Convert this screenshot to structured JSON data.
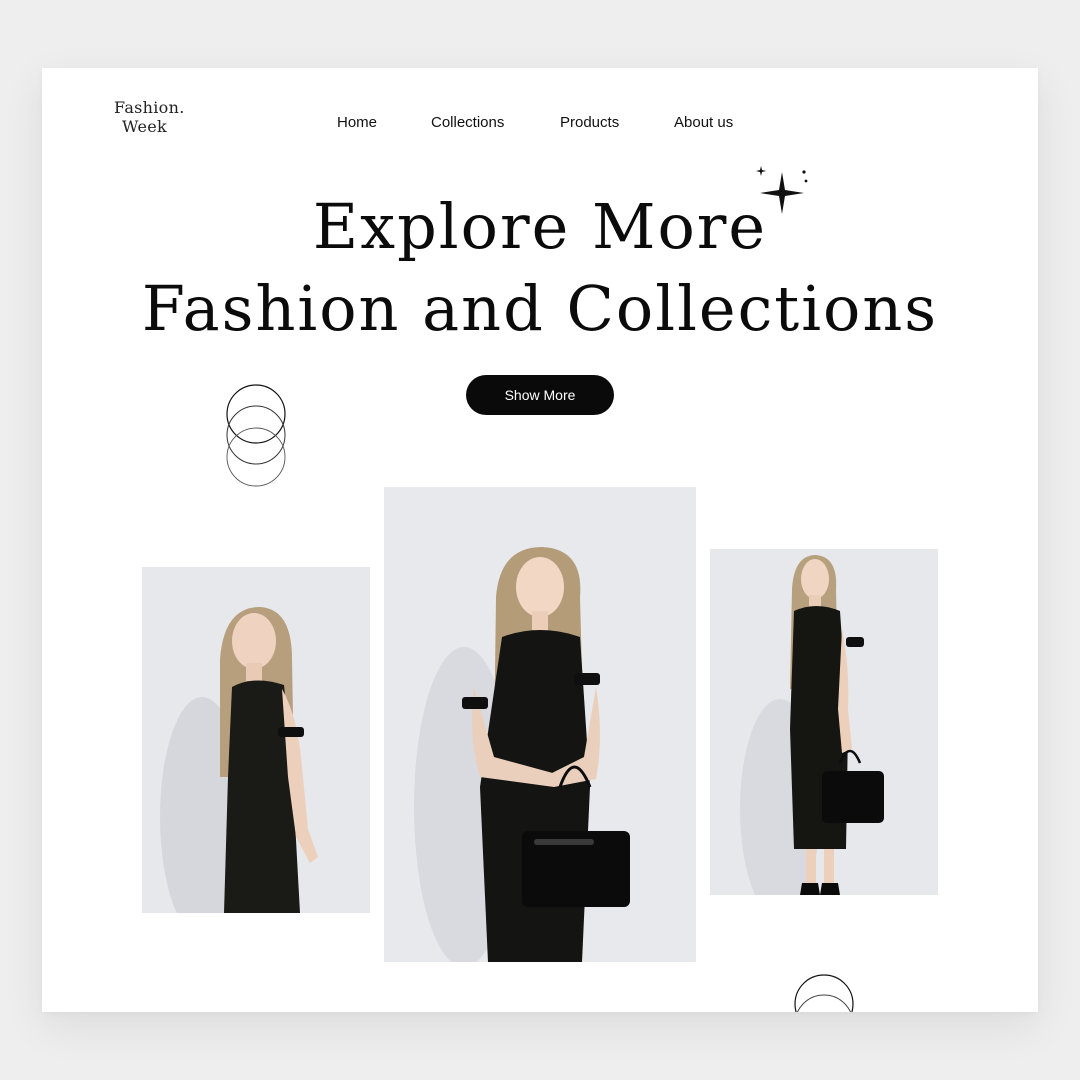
{
  "brand": {
    "line1": "Fashion.",
    "line2": "Week"
  },
  "nav": {
    "items": [
      {
        "label": "Home"
      },
      {
        "label": "Collections"
      },
      {
        "label": "Products"
      },
      {
        "label": "About us"
      }
    ]
  },
  "hero": {
    "title_line1": "Explore More",
    "title_line2": "Fashion and Collections",
    "button_label": "Show More"
  },
  "colors": {
    "background": "#eeeeef",
    "card": "#ffffff",
    "accent": "#0a0a0a",
    "button_text": "#ffffff"
  },
  "decor": {
    "sparkle_icon": "sparkle-icon",
    "rings_icon": "rings-icon",
    "arc_icon": "half-ring-icon"
  }
}
